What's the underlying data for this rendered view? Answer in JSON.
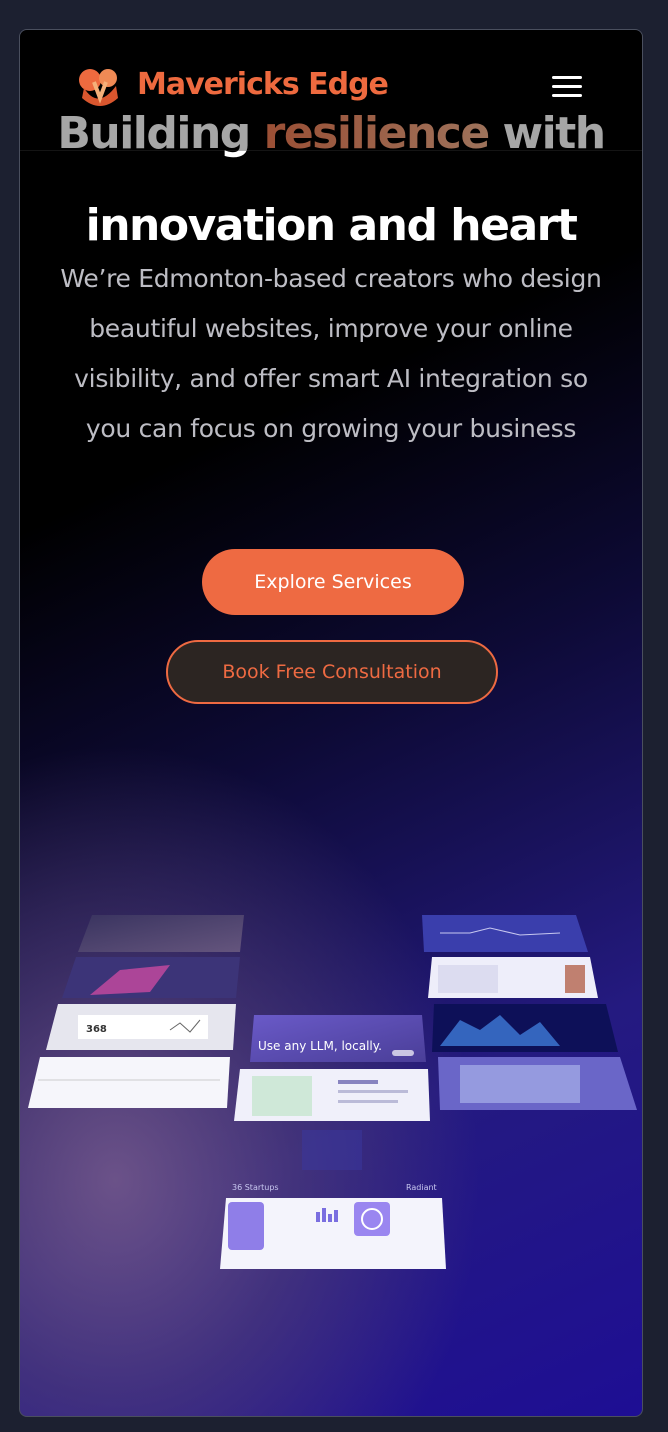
{
  "header": {
    "brand": "Mavericks Edge",
    "logo_icon": "mavericks-edge-logo-mark",
    "menu_icon": "hamburger-menu-icon"
  },
  "hero": {
    "title_part1": "Building",
    "title_accent": "resilience",
    "title_part2": "with",
    "title_line2": "innovation and heart",
    "subtitle": "We’re Edmonton-based creators who design beautiful websites, improve your online visibility, and offer smart AI integration so you can focus on growing your business",
    "primary_cta": "Explore Services",
    "secondary_cta": "Book Free Consultation"
  },
  "showcase": {
    "card_llm_text": "Use any LLM, locally.",
    "card_stat_value": "368",
    "caption_left": "36 Startups",
    "caption_right": "Radiant"
  },
  "colors": {
    "brand_orange": "#ee6a42",
    "background_dark": "#000000",
    "background_indigo": "#1e0e94",
    "page_frame": "#1c2030"
  }
}
